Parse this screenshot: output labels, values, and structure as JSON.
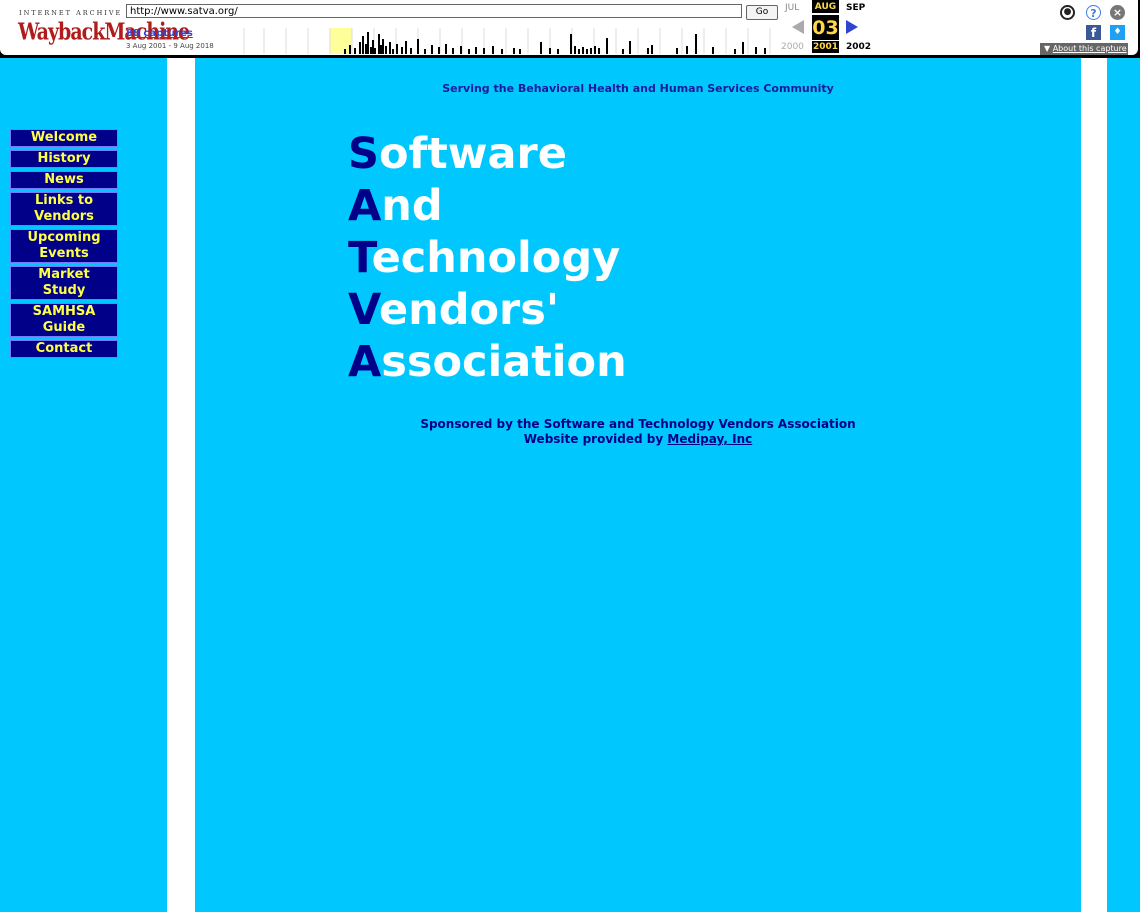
{
  "wayback": {
    "logo_small": "INTERNET ARCHIVE",
    "logo_big": "WaybackMachine",
    "url": "http://www.satva.org/",
    "go_label": "Go",
    "captures_label": "88 captures",
    "date_range": "3 Aug 2001 - 9 Aug 2018",
    "months": {
      "prev": "JUL",
      "current": "AUG",
      "next": "SEP"
    },
    "day": "03",
    "years": {
      "prev": "2000",
      "current": "2001",
      "next": "2002"
    },
    "about_label": "About this capture",
    "icons": [
      "user-icon",
      "help-icon",
      "close-icon",
      "facebook-icon",
      "twitter-icon"
    ],
    "sparkline_capture_positions": [
      120,
      125,
      130,
      135,
      138,
      141,
      143,
      146,
      148,
      150,
      154,
      156,
      158,
      161,
      165,
      168,
      172,
      177,
      181,
      186,
      193,
      200,
      207,
      214,
      221,
      228,
      236,
      244,
      251,
      259,
      268,
      277,
      289,
      295,
      316,
      325,
      333,
      346,
      350,
      354,
      358,
      362,
      366,
      370,
      374,
      382,
      398,
      405,
      423,
      427,
      452,
      462,
      471,
      488,
      510,
      518,
      531,
      540,
      554
    ],
    "sparkline_heights": [
      5,
      9,
      6,
      12,
      18,
      10,
      22,
      7,
      14,
      6,
      20,
      9,
      15,
      8,
      12,
      5,
      10,
      7,
      13,
      6,
      15,
      5,
      9,
      7,
      10,
      6,
      8,
      5,
      7,
      6,
      8,
      5,
      6,
      5,
      12,
      6,
      5,
      20,
      8,
      5,
      7,
      5,
      6,
      8,
      6,
      16,
      5,
      13,
      6,
      9,
      6,
      8,
      20,
      7,
      5,
      12,
      7,
      6,
      5
    ]
  },
  "page": {
    "tagline": "Serving the Behavioral Health and Human Services Community",
    "nav": [
      {
        "label": "Welcome"
      },
      {
        "label": "History"
      },
      {
        "label": "News"
      },
      {
        "label": "Links to Vendors"
      },
      {
        "label": "Upcoming Events"
      },
      {
        "label": "Market Study"
      },
      {
        "label": "SAMHSA Guide"
      },
      {
        "label": "Contact"
      }
    ],
    "acronym": [
      {
        "cap": "S",
        "rest": "oftware"
      },
      {
        "cap": "A",
        "rest": "nd"
      },
      {
        "cap": "T",
        "rest": "echnology"
      },
      {
        "cap": "V",
        "rest": "endors'"
      },
      {
        "cap": "A",
        "rest": "ssociation"
      }
    ],
    "sponsor_line": "Sponsored by the Software and Technology Vendors Association",
    "provided_prefix": "Website provided by",
    "provider_link": "Medipay, Inc"
  },
  "colors": {
    "background": "#00c8ff",
    "nav_bg": "#000088",
    "nav_text": "#ffff44",
    "acronym_cap": "#000088",
    "acronym_rest": "#ffffff"
  }
}
